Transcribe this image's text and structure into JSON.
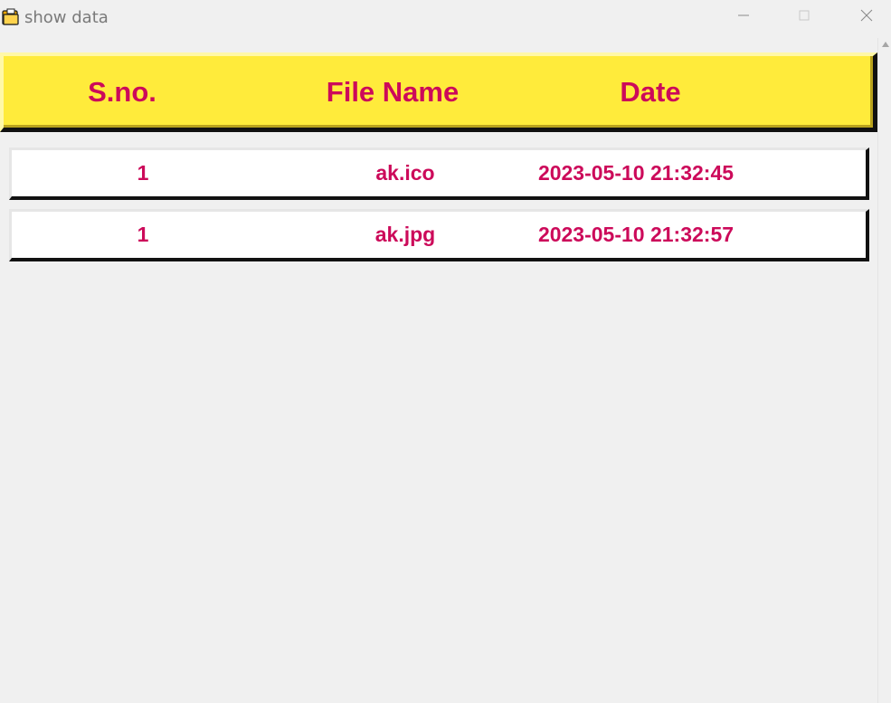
{
  "window": {
    "title": "show data",
    "controls": {
      "minimize": "minimize-icon",
      "maximize": "maximize-icon",
      "close": "close-icon"
    }
  },
  "colors": {
    "header_bg": "#ffeb3b",
    "text": "#cc0a5a",
    "row_bg": "#ffffff",
    "window_bg": "#f0f0f0"
  },
  "table": {
    "columns": [
      "S.no.",
      "File Name",
      "Date"
    ],
    "rows": [
      {
        "sno": "1",
        "file": "ak.ico",
        "date": "2023-05-10 21:32:45"
      },
      {
        "sno": "1",
        "file": "ak.jpg",
        "date": "2023-05-10 21:32:57"
      }
    ]
  }
}
